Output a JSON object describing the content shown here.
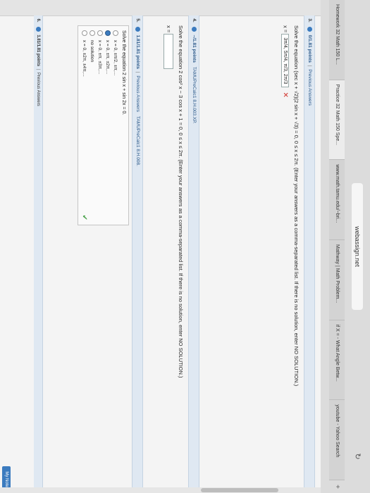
{
  "browser": {
    "url": "webassign.net",
    "tabs": [
      {
        "label": "Homework 32 Math 150 L...",
        "active": false
      },
      {
        "label": "Practice 32 Math 150 Spe...",
        "active": true
      },
      {
        "label": "www.math.tamu.edu/~bri...",
        "active": false
      },
      {
        "label": "Mathway | Math Problem...",
        "active": false
      },
      {
        "label": "if X = - What Angle Betw...",
        "active": false
      },
      {
        "label": "youtube - Yahoo Search",
        "active": false
      }
    ],
    "new_tab": "+"
  },
  "questions": [
    {
      "number": "3.",
      "points": "0/1.81 points",
      "status": "Previous Answers",
      "prompt": "Solve the equation  (sec x + √2)(2 sin x + √3) = 0, 0 ≤ x ≤ 2π.  (Enter your answers as a comma-separated list. If there is no solution, enter NO SOLUTION.)",
      "answer_label": "x =",
      "answer": "3π/4, 5π/4, π/3, 2π/3",
      "mark": "✕"
    },
    {
      "number": "4.",
      "points": "–/1.81 points",
      "ref": "TAMUPreCalc1 8.H.003.XP.",
      "prompt": "Solve the equation  2 cos² x − 3 cos x + 1 = 0, 0 ≤ x ≤ 2π.  (Enter your answers as a comma-separated list. If there is no solution, enter NO SOLUTION.)",
      "answer_label": "x ="
    },
    {
      "number": "5.",
      "points": "1.81/1.81 points",
      "status": "Previous Answers",
      "ref": "TAMUPreCalc1 8.H.008.",
      "prompt": "Solve the equation 2 sin x + sin 2x = 0.",
      "options": [
        {
          "text": "x = 0, ±π/2, ±π,...",
          "selected": false
        },
        {
          "text": "x = 0, ±π, ±2π,...",
          "selected": true
        },
        {
          "text": "x = 0, ±π, ±3π,...",
          "selected": false
        },
        {
          "text": "no solution",
          "selected": false
        },
        {
          "text": "x = 0, ±2π, ±4π,...",
          "selected": false
        }
      ],
      "mark": "✔"
    }
  ],
  "footer": {
    "number": "6.",
    "points": "1.81/1.81 points",
    "status": "Previous Answers"
  },
  "bottom_tab": "My Notes"
}
